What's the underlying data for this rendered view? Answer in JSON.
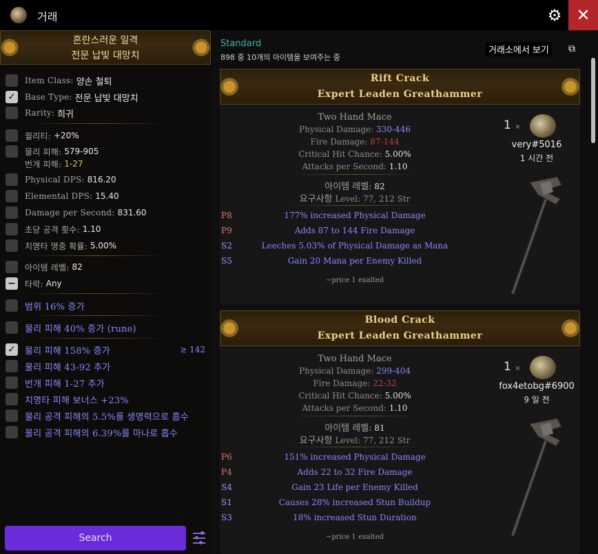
{
  "titlebar": {
    "title": "거래",
    "icons": {
      "app": "app-icon",
      "settings": "gear-icon",
      "close": "close-icon"
    }
  },
  "search_item": {
    "line1": "혼란스러운 일격",
    "line2": "전문 납빛 대망치"
  },
  "filters": {
    "item_class": {
      "label": "Item Class:",
      "value": "양손 철퇴"
    },
    "base_type": {
      "label": "Base Type:",
      "value": "전문 납빛 대망치"
    },
    "rarity": {
      "label": "Rarity:",
      "value": "희귀"
    },
    "quality": {
      "label": "퀄리티:",
      "value": "+20%"
    },
    "phys": {
      "label": "물리 피해:",
      "value": "579-905"
    },
    "light": {
      "label": "번개 피해:",
      "value": "1-27"
    },
    "pdps": {
      "label": "Physical DPS:",
      "value": "816.20"
    },
    "edps": {
      "label": "Elemental DPS:",
      "value": "15.40"
    },
    "dps": {
      "label": "Damage per Second:",
      "value": "831.60"
    },
    "aps": {
      "label": "초당 공격 횟수:",
      "value": "1.10"
    },
    "crit": {
      "label": "치명타 명중 확률:",
      "value": "5.00%"
    },
    "ilvl": {
      "label": "아이템 레벨:",
      "value": "82"
    },
    "hit": {
      "label": "타락:",
      "value": "Any"
    },
    "radius": {
      "text": "범위 16% 증가"
    },
    "phys_rune": {
      "text": "물리 피해 40% 증가 (rune)"
    },
    "phys_inc": {
      "text": "물리 피해 158% 증가",
      "range": "≥ 142"
    },
    "phys_add": {
      "text": "물리 피해 43-92 추가"
    },
    "light_add": {
      "text": "번개 피해 1-27 추가"
    },
    "crit_bonus": {
      "text": "치명타 피해 보너스 +23%"
    },
    "leech_life": {
      "text": "물리 공격 피해의 5.5%를 생명력으로 흡수"
    },
    "leech_mana": {
      "text": "물리 공격 피해의 6.39%를 마나로 흡수"
    }
  },
  "search_button": "Search",
  "results": {
    "league": "Standard",
    "count_text": "898 중 10개의 아이템을 보여주는 중",
    "market_link": "거래소에서 보기"
  },
  "cards": [
    {
      "name": "Rift Crack",
      "base": "Expert Leaden Greathammer",
      "type": "Two Hand Mace",
      "phys_label": "Physical Damage:",
      "phys": "330-446",
      "fire_label": "Fire Damage:",
      "fire": "87-144",
      "crit_label": "Critical Hit Chance:",
      "crit": "5.00%",
      "aps_label": "Attacks per Second:",
      "aps": "1.10",
      "ilvl_label": "아이템 레벨:",
      "ilvl": "82",
      "req_label": "요구사항",
      "req": "Level: 77, 212 Str",
      "mods": [
        {
          "tag": "P8",
          "text": "177% increased Physical Damage"
        },
        {
          "tag": "P9",
          "text": "Adds 87 to 144 Fire Damage"
        },
        {
          "tag": "S2",
          "text": "Leeches 5.03% of Physical Damage as Mana"
        },
        {
          "tag": "S5",
          "text": "Gain 20 Mana per Enemy Killed"
        }
      ],
      "price": "~price 1 exalted",
      "qty": "1",
      "times": "×",
      "seller": "very#5016",
      "ago": "1 시간 전"
    },
    {
      "name": "Blood Crack",
      "base": "Expert Leaden Greathammer",
      "type": "Two Hand Mace",
      "phys_label": "Physical Damage:",
      "phys": "299-404",
      "fire_label": "Fire Damage:",
      "fire": "22-32",
      "crit_label": "Critical Hit Chance:",
      "crit": "5.00%",
      "aps_label": "Attacks per Second:",
      "aps": "1.10",
      "ilvl_label": "아이템 레벨:",
      "ilvl": "81",
      "req_label": "요구사항",
      "req": "Level: 77, 212 Str",
      "mods": [
        {
          "tag": "P6",
          "text": "151% increased Physical Damage"
        },
        {
          "tag": "P4",
          "text": "Adds 22 to 32 Fire Damage"
        },
        {
          "tag": "S4",
          "text": "Gain 23 Life per Enemy Killed"
        },
        {
          "tag": "S1",
          "text": "Causes 28% increased Stun Buildup"
        },
        {
          "tag": "S3",
          "text": "18% increased Stun Duration"
        }
      ],
      "price": "~price 1 exalted",
      "qty": "1",
      "times": "×",
      "seller": "fox4etobg#6900",
      "ago": "9 일 전"
    }
  ]
}
